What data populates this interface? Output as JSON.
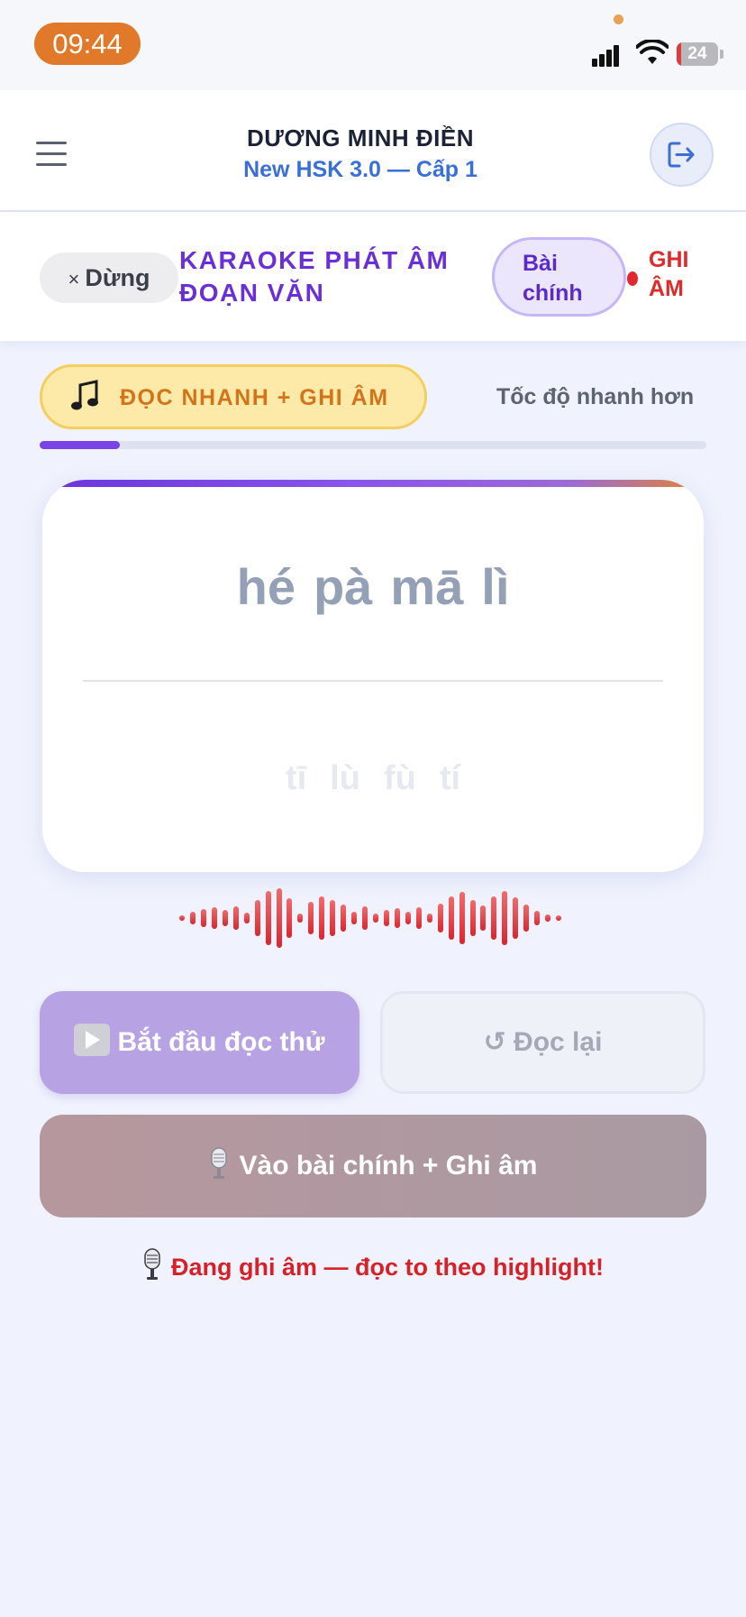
{
  "status_bar": {
    "time": "09:44",
    "battery": "24"
  },
  "header": {
    "user_name": "DƯƠNG MINH ĐIỀN",
    "course": "New HSK 3.0 — Cấp 1"
  },
  "karaoke": {
    "stop_label": "Dừng",
    "stop_icon": "×",
    "title": "KARAOKE PHÁT ÂM ĐOẠN VĂN",
    "badge": "Bài chính",
    "rec_label": "GHI ÂM",
    "rec_color": "#e0282e"
  },
  "mode": {
    "label": "ĐỌC NHANH + GHI ÂM",
    "speed_text": "Tốc độ nhanh hơn",
    "progress": 0.12
  },
  "card": {
    "current_line": [
      "hé",
      "pà",
      "mā",
      "lì"
    ],
    "next_line": [
      "tī",
      "lù",
      "fù",
      "tí"
    ]
  },
  "buttons": {
    "start_label": "Bắt đầu đọc thử",
    "reread_label": "↺ Đọc lại",
    "main_label": "Vào bài chính + Ghi âm"
  },
  "status_message": "Đang ghi âm — đọc to theo highlight!",
  "colors": {
    "accent": "#6a2fd6",
    "orange": "#e07a2a",
    "recording_red": "#d72128"
  }
}
